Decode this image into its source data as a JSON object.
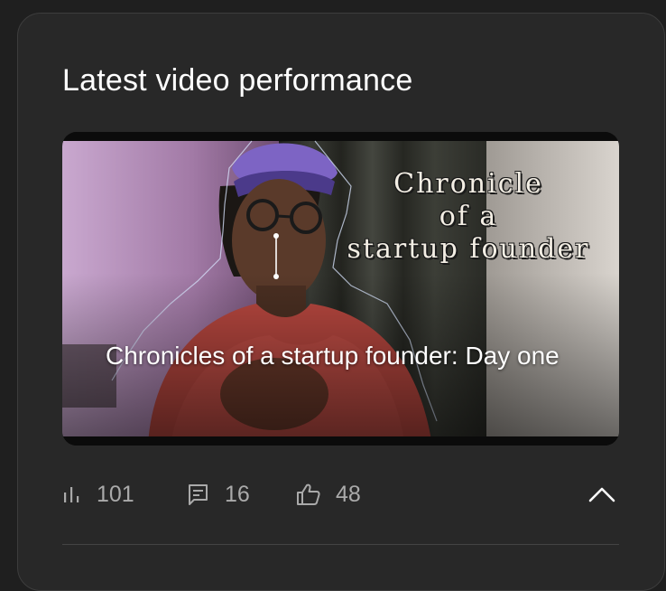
{
  "card": {
    "title": "Latest video performance"
  },
  "video": {
    "title": "Chronicles of a startup founder: Day one",
    "thumbnail_text": [
      "Chronicle",
      "of a",
      "startup founder"
    ]
  },
  "stats": {
    "views": {
      "value": "101",
      "icon": "bar-chart-icon"
    },
    "comments": {
      "value": "16",
      "icon": "comment-icon"
    },
    "likes": {
      "value": "48",
      "icon": "thumbs-up-icon"
    }
  },
  "collapse": {
    "icon": "chevron-up-icon"
  }
}
